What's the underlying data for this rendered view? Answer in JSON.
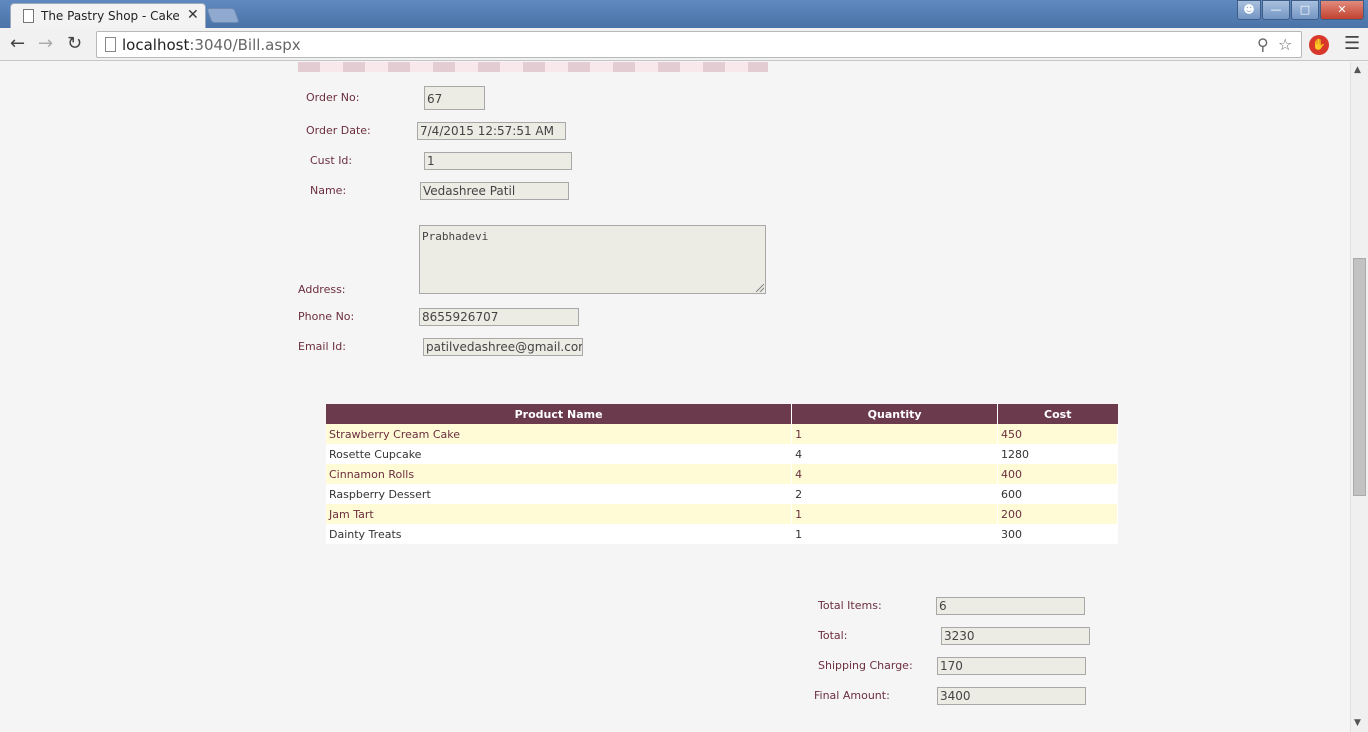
{
  "browser": {
    "tab_title": "The Pastry Shop - Cake D",
    "url_host": "localhost",
    "url_path": ":3040/Bill.aspx"
  },
  "form": {
    "order_no_label": "Order No:",
    "order_no_value": "67",
    "order_date_label": "Order Date:",
    "order_date_value": "7/4/2015 12:57:51 AM",
    "cust_id_label": "Cust Id:",
    "cust_id_value": "1",
    "name_label": "Name:",
    "name_value": "Vedashree Patil",
    "address_label": "Address:",
    "address_value": "Prabhadevi",
    "phone_label": "Phone No:",
    "phone_value": "8655926707",
    "email_label": "Email Id:",
    "email_value": "patilvedashree@gmail.com"
  },
  "table": {
    "headers": [
      "Product Name",
      "Quantity",
      "Cost"
    ],
    "rows": [
      [
        "Strawberry Cream Cake",
        "1",
        "450"
      ],
      [
        "Rosette Cupcake",
        "4",
        "1280"
      ],
      [
        "Cinnamon Rolls",
        "4",
        "400"
      ],
      [
        "Raspberry Dessert",
        "2",
        "600"
      ],
      [
        "Jam Tart",
        "1",
        "200"
      ],
      [
        "Dainty Treats",
        "1",
        "300"
      ]
    ]
  },
  "summary": {
    "total_items_label": "Total Items:",
    "total_items_value": "6",
    "total_label": "Total:",
    "total_value": "3230",
    "shipping_label": "Shipping Charge:",
    "shipping_value": "170",
    "final_label": "Final Amount:",
    "final_value": "3400"
  }
}
